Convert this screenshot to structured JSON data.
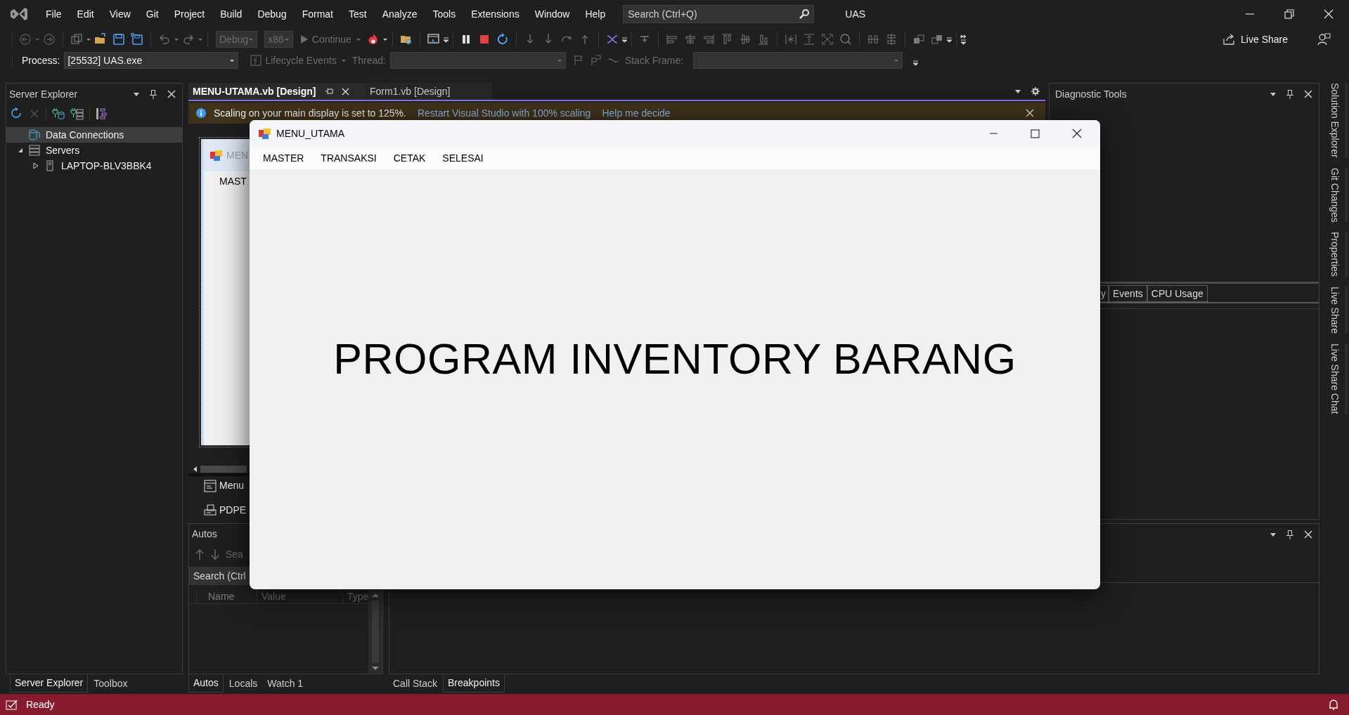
{
  "title_bar": {
    "menu": [
      "File",
      "Edit",
      "View",
      "Git",
      "Project",
      "Build",
      "Debug",
      "Format",
      "Test",
      "Analyze",
      "Tools",
      "Extensions",
      "Window",
      "Help"
    ],
    "search": {
      "placeholder": "Search (Ctrl+Q)"
    },
    "solution_name": "UAS"
  },
  "toolbar": {
    "configuration": "Debug",
    "platform": "x86",
    "continue": "Continue",
    "live_share": "Live Share"
  },
  "debug_location": {
    "process_label": "Process:",
    "process": "[25532] UAS.exe",
    "lifecycle": "Lifecycle Events",
    "thread_label": "Thread:",
    "stack_frame_label": "Stack Frame:"
  },
  "server_explorer": {
    "title": "Server Explorer",
    "tree": [
      {
        "label": "Data Connections",
        "kind": "connections",
        "selected": true
      },
      {
        "label": "Servers",
        "kind": "servers",
        "selected": false,
        "expanded": true,
        "children": [
          {
            "label": "LAPTOP-BLV3BBK4",
            "kind": "machine",
            "selected": false,
            "expanded": false
          }
        ]
      }
    ]
  },
  "left_tabs": [
    {
      "label": "Server Explorer",
      "selected": true
    },
    {
      "label": "Toolbox",
      "selected": false
    }
  ],
  "document_tabs": [
    {
      "label": "MENU-UTAMA.vb [Design]",
      "selected": true
    },
    {
      "label": "Form1.vb [Design]",
      "selected": false
    }
  ],
  "info_bar": {
    "message": "Scaling on your main display is set to 125%.",
    "links": [
      "Restart Visual Studio with 100% scaling",
      "Help me decide"
    ]
  },
  "designer": {
    "form_title": "MEN",
    "menu_item": "MAST",
    "components": [
      {
        "label": "Menu",
        "kind": "menu"
      },
      {
        "label": "PDPE",
        "kind": "print"
      }
    ]
  },
  "autos": {
    "title": "Autos",
    "search_hint": "Sea",
    "search": "Search (Ctrl",
    "columns": [
      "Name",
      "Value",
      "Type"
    ]
  },
  "autos_tabs": [
    {
      "label": "Autos",
      "selected": true
    },
    {
      "label": "Locals",
      "selected": false
    },
    {
      "label": "Watch 1",
      "selected": false
    }
  ],
  "bottom_tabs": [
    {
      "label": "Call Stack",
      "selected": false
    },
    {
      "label": "Breakpoints",
      "selected": true
    }
  ],
  "diagnostic_tools": {
    "title": "Diagnostic Tools",
    "tabs": [
      "y",
      "Events",
      "CPU Usage"
    ]
  },
  "side_tabs": [
    "Solution Explorer",
    "Git Changes",
    "Properties",
    "Live Share",
    "Live Share Chat"
  ],
  "status_bar": {
    "text": "Ready"
  },
  "running_form": {
    "title": "MENU_UTAMA",
    "menu": [
      "MASTER",
      "TRANSAKSI",
      "CETAK",
      "SELESAI"
    ],
    "heading": "PROGRAM INVENTORY BARANG"
  }
}
